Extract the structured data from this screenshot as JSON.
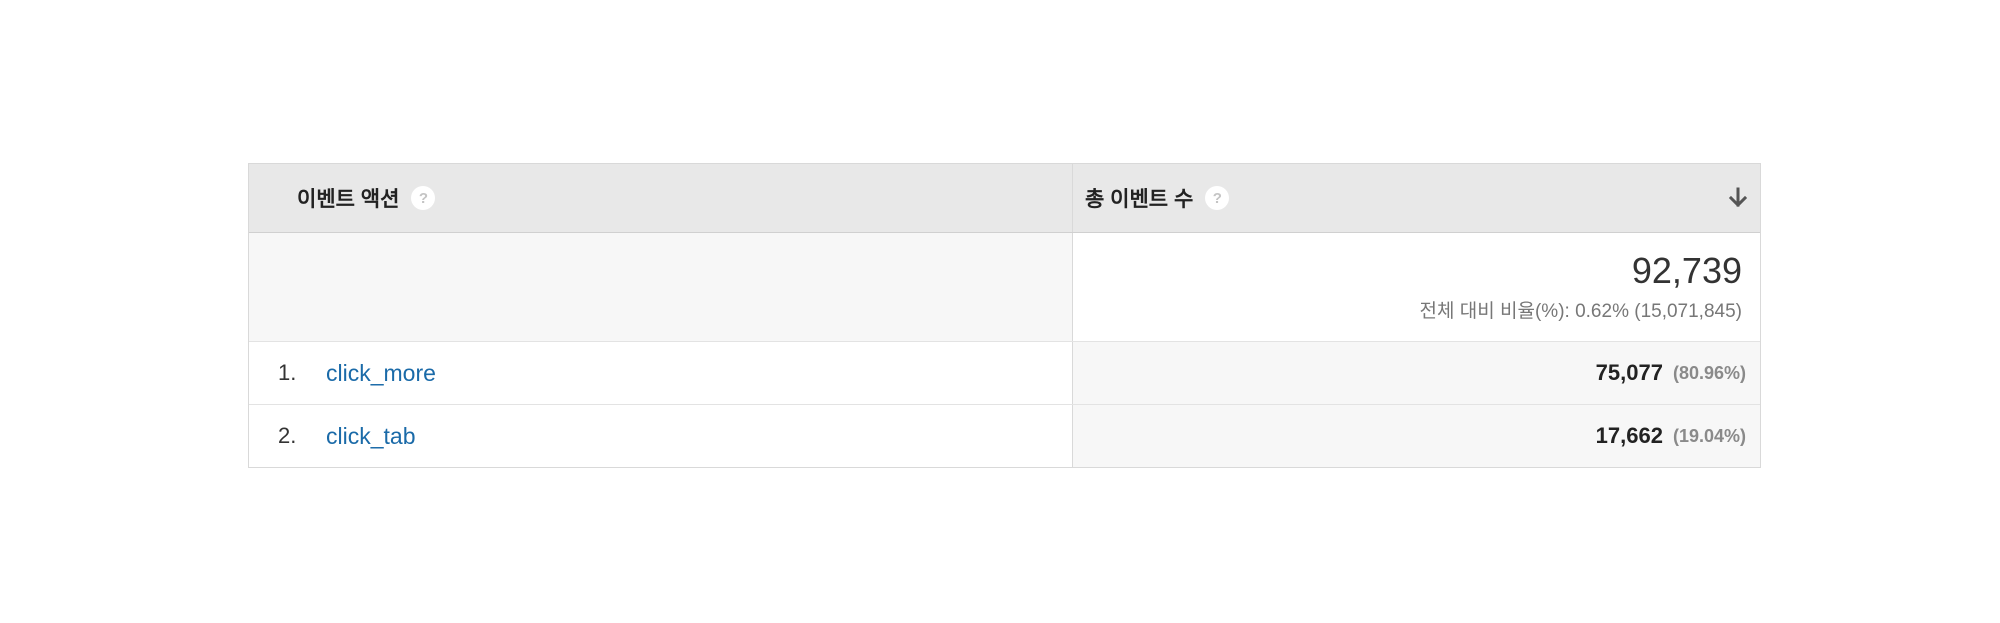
{
  "table": {
    "header": {
      "dimension_label": "이벤트 액션",
      "metric_label": "총 이벤트 수",
      "help_glyph": "?",
      "sort_icon": "arrow-down-icon"
    },
    "totals": {
      "value": "92,739",
      "percent_of_total": "전체 대비 비율(%): 0.62% (15,071,845)"
    },
    "rows": [
      {
        "index": "1.",
        "action": "click_more",
        "value": "75,077",
        "share": "(80.96%)"
      },
      {
        "index": "2.",
        "action": "click_tab",
        "value": "17,662",
        "share": "(19.04%)"
      }
    ]
  },
  "colors": {
    "header_bg": "#e8e8e8",
    "link": "#1a6aa8",
    "alt_bg": "#f7f7f7"
  }
}
